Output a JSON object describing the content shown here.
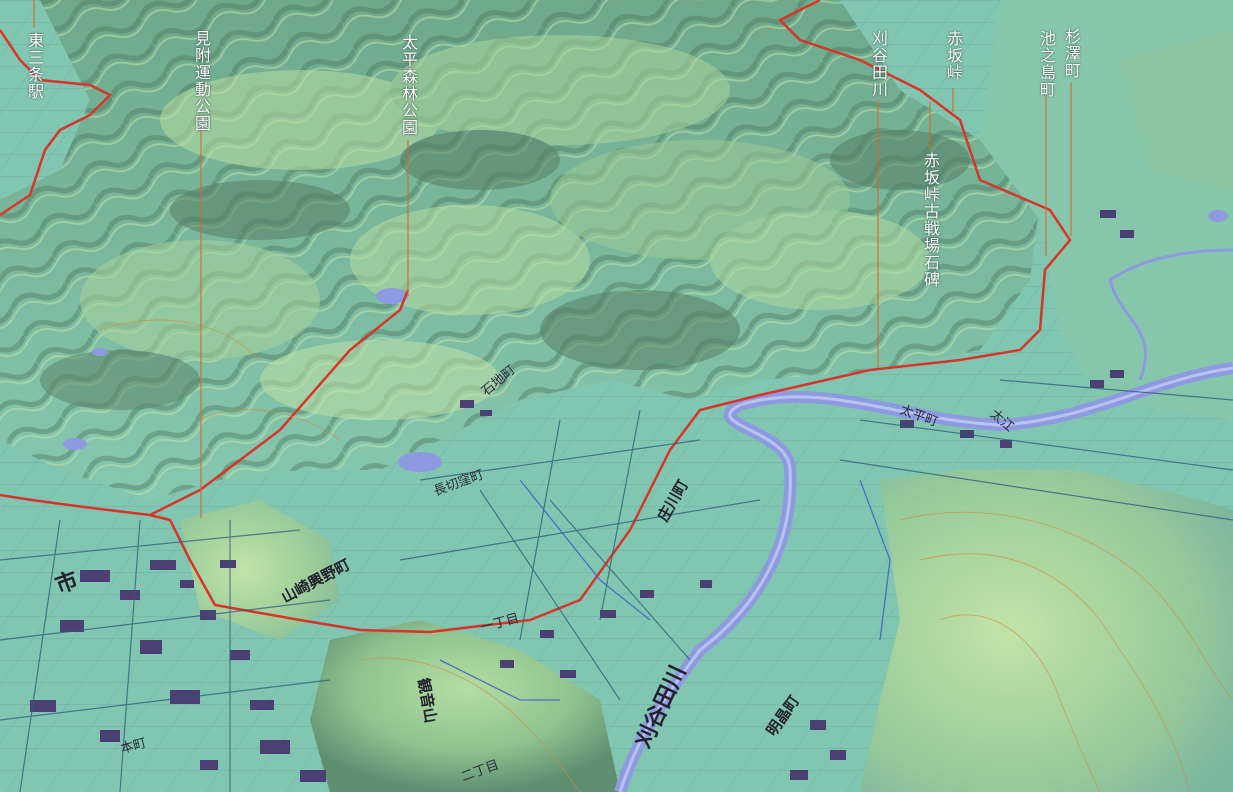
{
  "callouts": [
    {
      "id": "higashisanjo",
      "text": "東三条駅"
    },
    {
      "id": "mitsuke",
      "text": "見附運動公園"
    },
    {
      "id": "taihei",
      "text": "太平森林公園"
    },
    {
      "id": "kariyatagawa",
      "text": "刈谷田川"
    },
    {
      "id": "akasaka",
      "text": "赤坂峠"
    },
    {
      "id": "akasaka-kosenjo",
      "text": "赤坂峠古戦場石碑"
    },
    {
      "id": "ikenoshima",
      "text": "池之島町"
    },
    {
      "id": "sugisawa",
      "text": "杉澤町"
    }
  ],
  "map_labels": {
    "shi": "市",
    "river": "刈谷田川",
    "yamasaki": "山崎興野町",
    "shouji": "庄川町",
    "akebono": "明晶町",
    "kanon": "観音山",
    "nagakiri": "長切窪町",
    "ishigami": "石地町",
    "honmachi": "本町",
    "taiheimachi": "太平町",
    "oe": "太江",
    "chome1": "一丁目",
    "chome2": "二丁目"
  },
  "colors": {
    "plain": "#7fc4ae",
    "hill_light": "#a9d79d",
    "hill_dark": "#4f7d63",
    "road_red": "#d8352a",
    "river": "#8d9ae0",
    "building": "#4b3f73",
    "callout_line": "#d46a2a"
  }
}
